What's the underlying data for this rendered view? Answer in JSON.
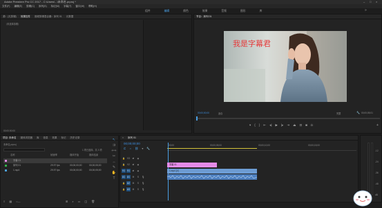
{
  "app": {
    "title": "Adobe Premiere Pro CC 2017 - C:\\Users\\...\\未命名.prproj *"
  },
  "menu": [
    "文件(F)",
    "编辑(E)",
    "剪辑(C)",
    "序列(S)",
    "标记(M)",
    "字幕(T)",
    "窗口(W)",
    "帮助(H)"
  ],
  "workspaces": [
    "组件",
    "编辑",
    "颜色",
    "效果",
    "音频",
    "图形",
    "库"
  ],
  "workspaces_active": "编辑",
  "source_panel": {
    "tabs": [
      "源：(无剪辑)",
      "效果控件",
      "音频剪辑混合器：序列 01",
      "元数据"
    ],
    "active_tab": "效果控件",
    "message": "（未选择剪辑）"
  },
  "program_monitor": {
    "tab": "节目：序列 01",
    "overlay_text": "我是字幕君",
    "timecode_left": "00;00;00;00",
    "zoom": "适合",
    "quality": "完整",
    "timecode_right": "00;00;05;01"
  },
  "project_panel": {
    "tabs": [
      "项目: 未命名",
      "媒体浏览器",
      "库",
      "信息",
      "效果",
      "标记",
      "历史记录"
    ],
    "active_tab": "项目: 未命名",
    "file": "未命名.prproj",
    "item_count": "1 项已选择，共 3 项",
    "columns": [
      "名称",
      "帧速率",
      "媒体开始",
      "媒体结束"
    ],
    "rows": [
      {
        "name": "字幕 01",
        "fps": "",
        "start": "",
        "end": "",
        "color": "#e58be8"
      },
      {
        "name": "序列 01",
        "fps": "29.97 fps",
        "start": "00;00;00;00",
        "end": "00;00;05;00",
        "color": "#33b04b"
      },
      {
        "name": "1.mp4",
        "fps": "29.97 fps",
        "start": "00;00;00;00",
        "end": "00;00;05;00",
        "color": "#4c9fd8"
      }
    ]
  },
  "timeline": {
    "tab": "序列 01",
    "timecode": "00;00;00;00",
    "ruler": [
      "00;00",
      "00;00;05;00",
      "00;00;10;00",
      "00;00;15;00"
    ],
    "tracks": [
      "V3",
      "V2",
      "V1",
      "A1",
      "A2",
      "A3"
    ],
    "clips": {
      "title_clip": "字幕 01",
      "video_clip": "1.mp4 [V]"
    },
    "audio_meter_labels": [
      "-12",
      "-24",
      "-36",
      "-48",
      "dB"
    ]
  }
}
